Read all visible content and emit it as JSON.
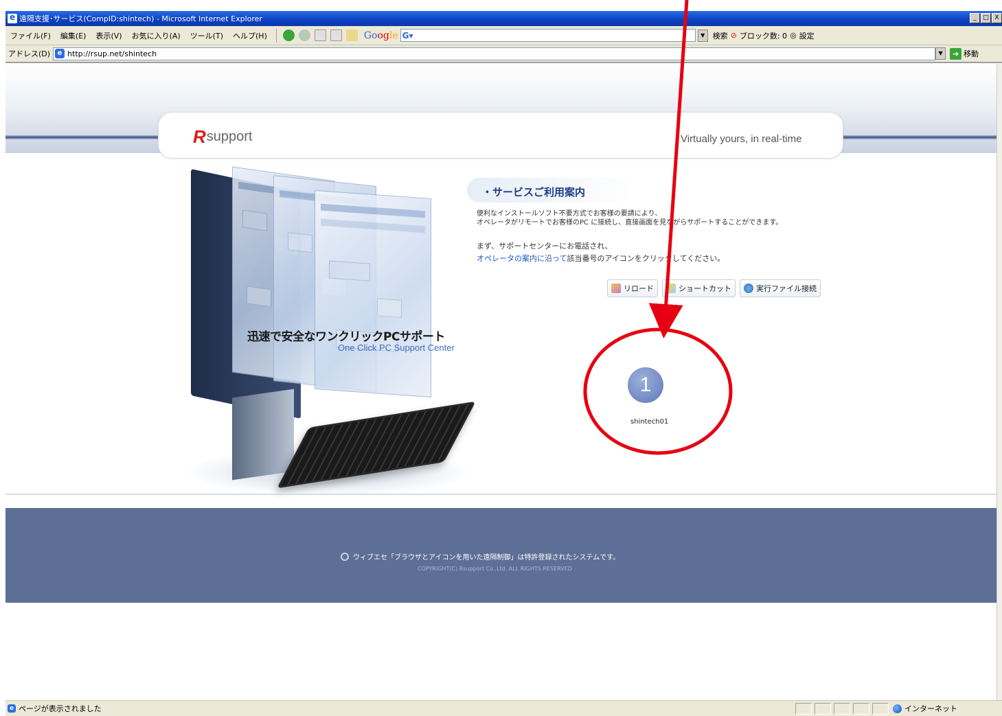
{
  "window": {
    "title": "遠隔支援･サービス(CompID:shintech) - Microsoft Internet Explorer",
    "buttons": [
      "_",
      "□",
      "X"
    ]
  },
  "menu": {
    "items": [
      "ファイル(F)",
      "編集(E)",
      "表示(V)",
      "お気に入り(A)",
      "ツール(T)",
      "ヘルプ(H)"
    ]
  },
  "google_toolbar": {
    "logo": [
      "Go",
      "og",
      "le"
    ],
    "search_label": "検索",
    "popup_label": "ブロック数: 0",
    "settings_label": "設定"
  },
  "address": {
    "label": "アドレス(D)",
    "url": "http://rsup.net/shintech",
    "go_label": "移動"
  },
  "page": {
    "logo_text": "support",
    "tagline": "Virtually yours, in real-time",
    "promo_title": "迅速で安全なワンクリックPCサポート",
    "promo_subtitle": "One Click PC Support Center",
    "service_title": "・サービスご利用案内",
    "intro_line1": "便利なインストールソフト不要方式でお客様の要請により、",
    "intro_line2": "オペレータがリモートでお客様のPC に接続し、直接画面を見ながらサポートすることができます。",
    "step_line1": "まず、サポートセンターにお電話され、",
    "step_link": "オペレータの案内に沿って",
    "step_line2_rest": "該当番号のアイコンをクリックしてください。",
    "buttons": {
      "reload": "リロード",
      "shortcut": "ショートカット",
      "exec": "実行ファイル接続"
    },
    "user_number": "1",
    "user_label": "shintech01",
    "footer_text": "ウィブエセ「ブラウザとアイコンを用いた遠隔制御」は特許登録されたシステムです。",
    "footer_copy": "COPYRIGHT(C) Rsupport Co.,Ltd. ALL RIGHTS RESERVED"
  },
  "status": {
    "text": "ページが表示されました",
    "zone": "インターネット"
  },
  "colors": {
    "ie_title": "#0a3fbf",
    "brand_red": "#d81c1c",
    "navy": "#1d3d86",
    "footer_bg": "#5d6f96",
    "annotation_red": "#e60012"
  },
  "icons": {
    "user": "numbered-circle-icon",
    "reload": "reload-icon",
    "shortcut": "shortcut-icon",
    "exec": "exec-file-icon"
  }
}
